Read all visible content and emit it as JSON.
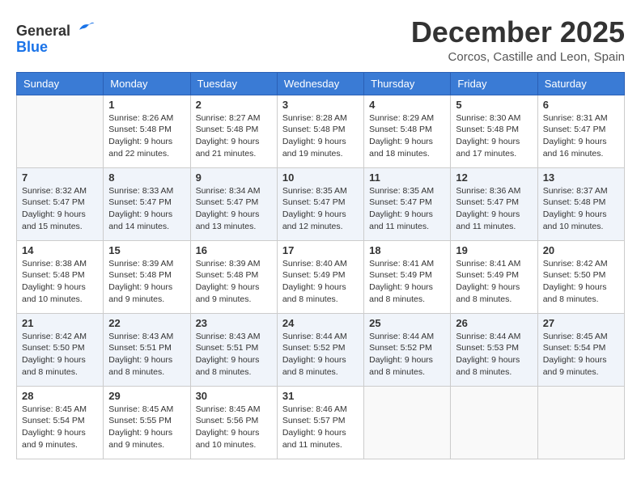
{
  "logo": {
    "line1": "General",
    "line2": "Blue"
  },
  "title": "December 2025",
  "subtitle": "Corcos, Castille and Leon, Spain",
  "days_of_week": [
    "Sunday",
    "Monday",
    "Tuesday",
    "Wednesday",
    "Thursday",
    "Friday",
    "Saturday"
  ],
  "weeks": [
    [
      {
        "day": "",
        "sunrise": "",
        "sunset": "",
        "daylight": ""
      },
      {
        "day": "1",
        "sunrise": "Sunrise: 8:26 AM",
        "sunset": "Sunset: 5:48 PM",
        "daylight": "Daylight: 9 hours and 22 minutes."
      },
      {
        "day": "2",
        "sunrise": "Sunrise: 8:27 AM",
        "sunset": "Sunset: 5:48 PM",
        "daylight": "Daylight: 9 hours and 21 minutes."
      },
      {
        "day": "3",
        "sunrise": "Sunrise: 8:28 AM",
        "sunset": "Sunset: 5:48 PM",
        "daylight": "Daylight: 9 hours and 19 minutes."
      },
      {
        "day": "4",
        "sunrise": "Sunrise: 8:29 AM",
        "sunset": "Sunset: 5:48 PM",
        "daylight": "Daylight: 9 hours and 18 minutes."
      },
      {
        "day": "5",
        "sunrise": "Sunrise: 8:30 AM",
        "sunset": "Sunset: 5:48 PM",
        "daylight": "Daylight: 9 hours and 17 minutes."
      },
      {
        "day": "6",
        "sunrise": "Sunrise: 8:31 AM",
        "sunset": "Sunset: 5:47 PM",
        "daylight": "Daylight: 9 hours and 16 minutes."
      }
    ],
    [
      {
        "day": "7",
        "sunrise": "Sunrise: 8:32 AM",
        "sunset": "Sunset: 5:47 PM",
        "daylight": "Daylight: 9 hours and 15 minutes."
      },
      {
        "day": "8",
        "sunrise": "Sunrise: 8:33 AM",
        "sunset": "Sunset: 5:47 PM",
        "daylight": "Daylight: 9 hours and 14 minutes."
      },
      {
        "day": "9",
        "sunrise": "Sunrise: 8:34 AM",
        "sunset": "Sunset: 5:47 PM",
        "daylight": "Daylight: 9 hours and 13 minutes."
      },
      {
        "day": "10",
        "sunrise": "Sunrise: 8:35 AM",
        "sunset": "Sunset: 5:47 PM",
        "daylight": "Daylight: 9 hours and 12 minutes."
      },
      {
        "day": "11",
        "sunrise": "Sunrise: 8:35 AM",
        "sunset": "Sunset: 5:47 PM",
        "daylight": "Daylight: 9 hours and 11 minutes."
      },
      {
        "day": "12",
        "sunrise": "Sunrise: 8:36 AM",
        "sunset": "Sunset: 5:47 PM",
        "daylight": "Daylight: 9 hours and 11 minutes."
      },
      {
        "day": "13",
        "sunrise": "Sunrise: 8:37 AM",
        "sunset": "Sunset: 5:48 PM",
        "daylight": "Daylight: 9 hours and 10 minutes."
      }
    ],
    [
      {
        "day": "14",
        "sunrise": "Sunrise: 8:38 AM",
        "sunset": "Sunset: 5:48 PM",
        "daylight": "Daylight: 9 hours and 10 minutes."
      },
      {
        "day": "15",
        "sunrise": "Sunrise: 8:39 AM",
        "sunset": "Sunset: 5:48 PM",
        "daylight": "Daylight: 9 hours and 9 minutes."
      },
      {
        "day": "16",
        "sunrise": "Sunrise: 8:39 AM",
        "sunset": "Sunset: 5:48 PM",
        "daylight": "Daylight: 9 hours and 9 minutes."
      },
      {
        "day": "17",
        "sunrise": "Sunrise: 8:40 AM",
        "sunset": "Sunset: 5:49 PM",
        "daylight": "Daylight: 9 hours and 8 minutes."
      },
      {
        "day": "18",
        "sunrise": "Sunrise: 8:41 AM",
        "sunset": "Sunset: 5:49 PM",
        "daylight": "Daylight: 9 hours and 8 minutes."
      },
      {
        "day": "19",
        "sunrise": "Sunrise: 8:41 AM",
        "sunset": "Sunset: 5:49 PM",
        "daylight": "Daylight: 9 hours and 8 minutes."
      },
      {
        "day": "20",
        "sunrise": "Sunrise: 8:42 AM",
        "sunset": "Sunset: 5:50 PM",
        "daylight": "Daylight: 9 hours and 8 minutes."
      }
    ],
    [
      {
        "day": "21",
        "sunrise": "Sunrise: 8:42 AM",
        "sunset": "Sunset: 5:50 PM",
        "daylight": "Daylight: 9 hours and 8 minutes."
      },
      {
        "day": "22",
        "sunrise": "Sunrise: 8:43 AM",
        "sunset": "Sunset: 5:51 PM",
        "daylight": "Daylight: 9 hours and 8 minutes."
      },
      {
        "day": "23",
        "sunrise": "Sunrise: 8:43 AM",
        "sunset": "Sunset: 5:51 PM",
        "daylight": "Daylight: 9 hours and 8 minutes."
      },
      {
        "day": "24",
        "sunrise": "Sunrise: 8:44 AM",
        "sunset": "Sunset: 5:52 PM",
        "daylight": "Daylight: 9 hours and 8 minutes."
      },
      {
        "day": "25",
        "sunrise": "Sunrise: 8:44 AM",
        "sunset": "Sunset: 5:52 PM",
        "daylight": "Daylight: 9 hours and 8 minutes."
      },
      {
        "day": "26",
        "sunrise": "Sunrise: 8:44 AM",
        "sunset": "Sunset: 5:53 PM",
        "daylight": "Daylight: 9 hours and 8 minutes."
      },
      {
        "day": "27",
        "sunrise": "Sunrise: 8:45 AM",
        "sunset": "Sunset: 5:54 PM",
        "daylight": "Daylight: 9 hours and 9 minutes."
      }
    ],
    [
      {
        "day": "28",
        "sunrise": "Sunrise: 8:45 AM",
        "sunset": "Sunset: 5:54 PM",
        "daylight": "Daylight: 9 hours and 9 minutes."
      },
      {
        "day": "29",
        "sunrise": "Sunrise: 8:45 AM",
        "sunset": "Sunset: 5:55 PM",
        "daylight": "Daylight: 9 hours and 9 minutes."
      },
      {
        "day": "30",
        "sunrise": "Sunrise: 8:45 AM",
        "sunset": "Sunset: 5:56 PM",
        "daylight": "Daylight: 9 hours and 10 minutes."
      },
      {
        "day": "31",
        "sunrise": "Sunrise: 8:46 AM",
        "sunset": "Sunset: 5:57 PM",
        "daylight": "Daylight: 9 hours and 11 minutes."
      },
      {
        "day": "",
        "sunrise": "",
        "sunset": "",
        "daylight": ""
      },
      {
        "day": "",
        "sunrise": "",
        "sunset": "",
        "daylight": ""
      },
      {
        "day": "",
        "sunrise": "",
        "sunset": "",
        "daylight": ""
      }
    ]
  ]
}
